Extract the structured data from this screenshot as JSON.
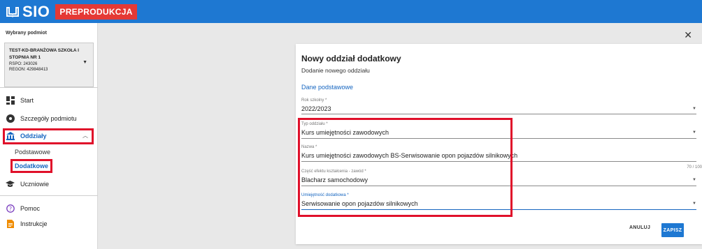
{
  "header": {
    "logo_text": "SIO",
    "env_badge": "PREPRODUKCJA",
    "bg_color": "#1e78d2",
    "badge_color": "#e53935"
  },
  "sidebar": {
    "selected_label": "Wybrany podmiot",
    "entity": {
      "name": "TEST-KD-BRANŻOWA SZKOŁA I STOPNIA NR 1",
      "rspo": "RSPO: 243026",
      "regon": "REGON: 429848413"
    },
    "items": [
      {
        "label": "Start",
        "icon": "dashboard-icon"
      },
      {
        "label": "Szczegóły podmiotu",
        "icon": "details-icon"
      },
      {
        "label": "Oddziały",
        "icon": "building-icon",
        "expanded": true
      },
      {
        "label": "Uczniowie",
        "icon": "graduation-cap-icon"
      },
      {
        "label": "Pomoc",
        "icon": "help-icon"
      },
      {
        "label": "Instrukcje",
        "icon": "document-icon"
      }
    ],
    "subitems": [
      {
        "label": "Podstawowe"
      },
      {
        "label": "Dodatkowe",
        "active": true
      }
    ]
  },
  "dialog": {
    "title": "Nowy oddział dodatkowy",
    "subtitle": "Dodanie nowego oddziału",
    "section": "Dane podstawowe",
    "fields": {
      "rok": {
        "label": "Rok szkolny *",
        "value": "2022/2023"
      },
      "typ": {
        "label": "Typ oddziału *",
        "value": "Kurs umiejętności zawodowych"
      },
      "nazwa": {
        "label": "Nazwa *",
        "value": "Kurs umiejętności zawodowych BS-Serwisowanie opon pojazdów silnikowych",
        "counter": "70 / 100"
      },
      "czesc": {
        "label": "Część efektu kształcenia - zawód *",
        "value": "Blacharz samochodowy"
      },
      "umiejetnosc": {
        "label": "Umiejętność dodatkowa *",
        "value": "Serwisowanie opon pojazdów silnikowych"
      }
    },
    "cancel_label": "ANULUJ",
    "save_label": "ZAPISZ"
  }
}
